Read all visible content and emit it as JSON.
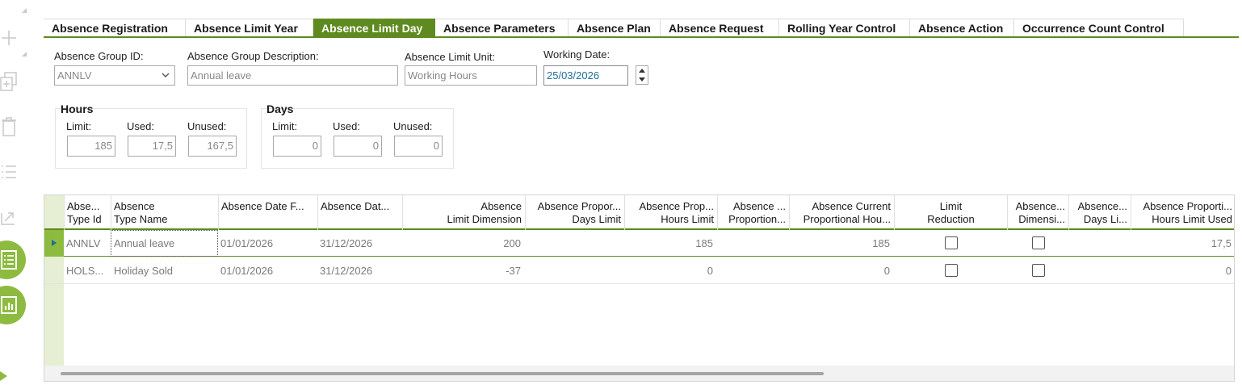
{
  "tabs": [
    {
      "label": "Absence Registration"
    },
    {
      "label": "Absence Limit Year"
    },
    {
      "label": "Absence Limit Day"
    },
    {
      "label": "Absence Parameters"
    },
    {
      "label": "Absence Plan"
    },
    {
      "label": "Absence Request"
    },
    {
      "label": "Rolling Year Control"
    },
    {
      "label": "Absence Action"
    },
    {
      "label": "Occurrence Count Control"
    }
  ],
  "active_tab": "Absence Limit Day",
  "form": {
    "group_id_label": "Absence Group ID:",
    "group_id_value": "ANNLV",
    "group_desc_label": "Absence Group Description:",
    "group_desc_value": "Annual leave",
    "limit_unit_label": "Absence Limit Unit:",
    "limit_unit_value": "Working Hours",
    "working_date_label": "Working Date:",
    "working_date_value": "25/03/2026"
  },
  "hours": {
    "title": "Hours",
    "limit_label": "Limit:",
    "limit_value": "185",
    "used_label": "Used:",
    "used_value": "17,5",
    "unused_label": "Unused:",
    "unused_value": "167,5"
  },
  "days": {
    "title": "Days",
    "limit_label": "Limit:",
    "limit_value": "0",
    "used_label": "Used:",
    "used_value": "0",
    "unused_label": "Unused:",
    "unused_value": "0"
  },
  "table": {
    "columns": [
      {
        "l1": "Abse...",
        "l2": "Type Id"
      },
      {
        "l1": "Absence",
        "l2": "Type Name"
      },
      {
        "l1": "Absence Date F...",
        "l2": ""
      },
      {
        "l1": "Absence Dat...",
        "l2": ""
      },
      {
        "l1": "Absence",
        "l2": "Limit Dimension"
      },
      {
        "l1": "Absence Propor...",
        "l2": "Days Limit"
      },
      {
        "l1": "Absence Prop...",
        "l2": "Hours Limit"
      },
      {
        "l1": "Absence ...",
        "l2": "Proportion..."
      },
      {
        "l1": "Absence Current",
        "l2": "Proportional Hou..."
      },
      {
        "l1": "Limit",
        "l2": "Reduction"
      },
      {
        "l1": "Absence...",
        "l2": "Dimensi..."
      },
      {
        "l1": "Absence...",
        "l2": "Days Li..."
      },
      {
        "l1": "Absence Proporti...",
        "l2": "Hours Limit Used"
      }
    ],
    "rows": [
      {
        "type_id": "ANNLV",
        "type_name": "Annual leave",
        "date_from": "01/01/2026",
        "date_to": "31/12/2026",
        "limit_dimension": "200",
        "days_limit": "",
        "hours_limit": "185",
        "proportion": "",
        "current_prop_hours": "185",
        "limit_reduction": false,
        "dimension_flag": false,
        "days_limit_used": "",
        "hours_limit_used": "17,5"
      },
      {
        "type_id": "HOLS...",
        "type_name": "Holiday Sold",
        "date_from": "01/01/2026",
        "date_to": "31/12/2026",
        "limit_dimension": "-37",
        "days_limit": "",
        "hours_limit": "0",
        "proportion": "",
        "current_prop_hours": "0",
        "limit_reduction": false,
        "dimension_flag": false,
        "days_limit_used": "",
        "hours_limit_used": "0"
      }
    ]
  },
  "colors": {
    "accent": "#5e8a1f",
    "accent_light": "#8dbb3f",
    "date_text": "#1e6f96"
  }
}
